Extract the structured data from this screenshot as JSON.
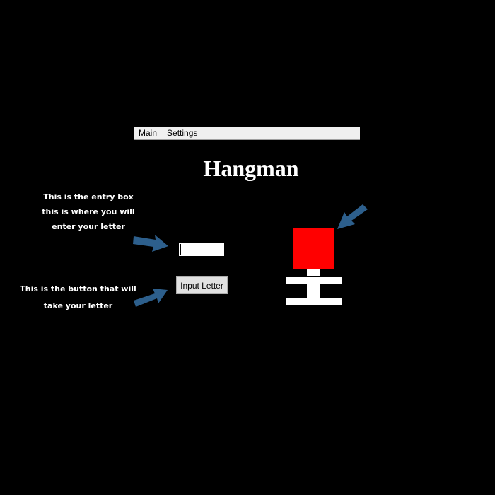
{
  "menu": {
    "items": [
      "Main",
      "Settings"
    ]
  },
  "title": "Hangman",
  "annotations": {
    "entry_lines": [
      "This is the entry box",
      "this is where you will",
      "enter your letter"
    ],
    "button_lines": [
      "This is the button that will",
      "take your letter"
    ]
  },
  "entry": {
    "value": "",
    "placeholder": ""
  },
  "button": {
    "label": "Input Letter"
  },
  "colors": {
    "background": "#000000",
    "arrow": "#2d5f8c",
    "head": "#ff0000",
    "gallows": "#ffffff"
  },
  "icons": [
    "arrow-right-icon",
    "arrow-down-left-icon"
  ]
}
